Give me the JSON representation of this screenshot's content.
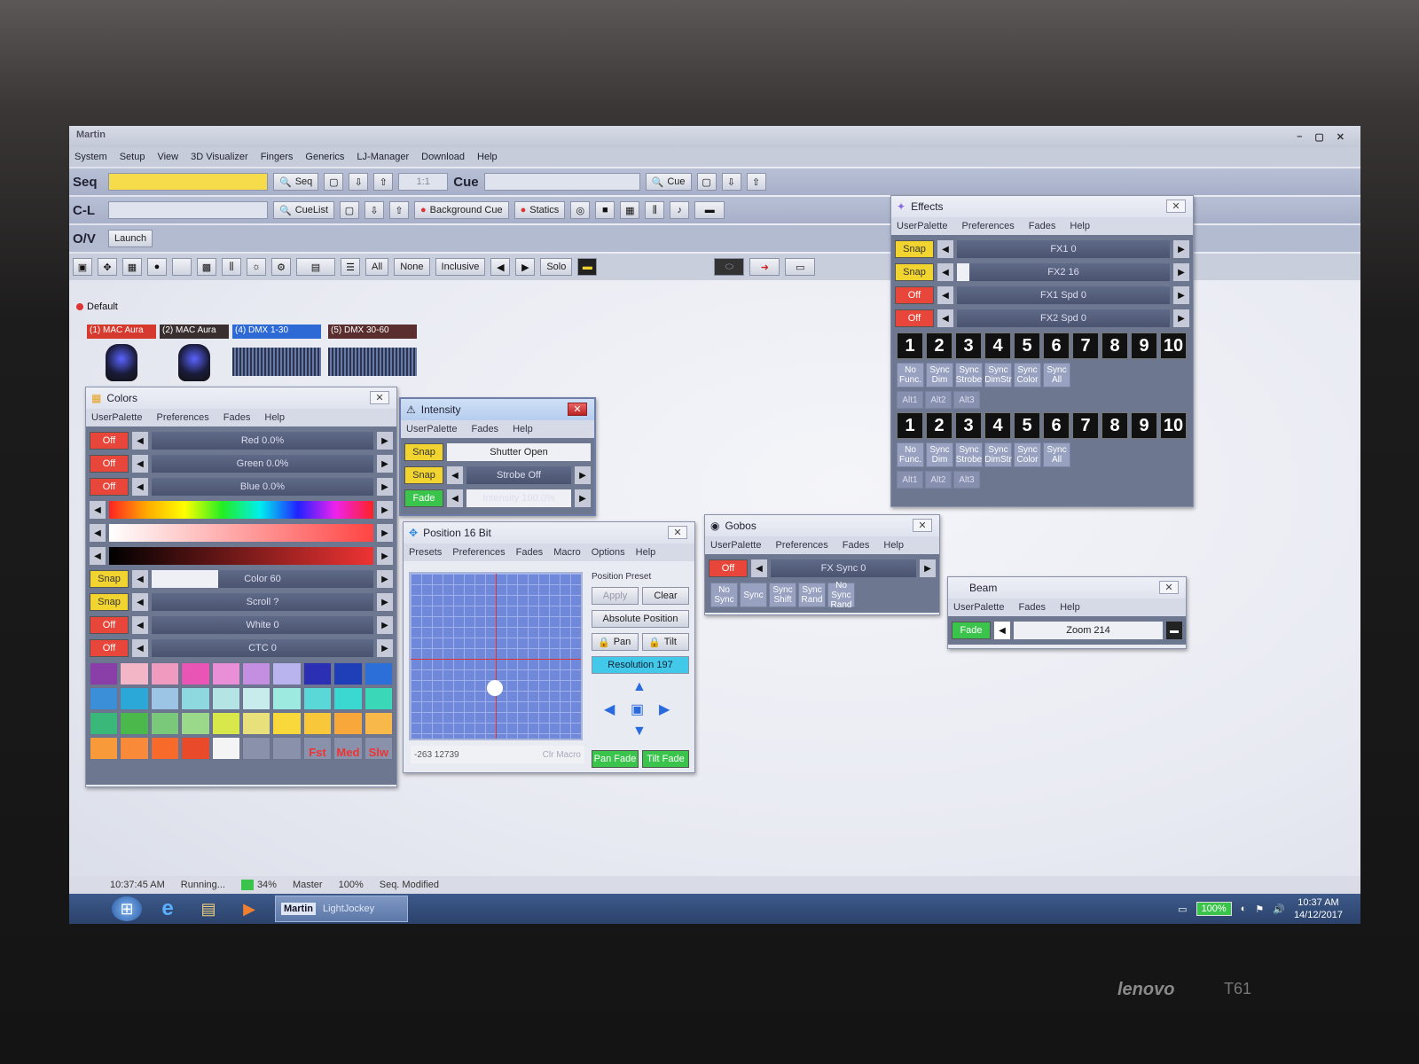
{
  "app": {
    "title": "Martin",
    "win_controls": [
      "–",
      "▢",
      "✕"
    ]
  },
  "menu": [
    "System",
    "Setup",
    "View",
    "3D Visualizer",
    "Fingers",
    "Generics",
    "LJ-Manager",
    "Download",
    "Help"
  ],
  "seq_row": {
    "label": "Seq",
    "seq_btn": "Seq",
    "ratio": "1:1",
    "cue_label": "Cue",
    "cue_btn": "Cue"
  },
  "cl_row": {
    "label": "C-L",
    "cuelist_btn": "CueList",
    "bg_cue_btn": "Background Cue",
    "statics_btn": "Statics"
  },
  "ov_row": {
    "label": "O/V",
    "launch_btn": "Launch"
  },
  "toolbar": {
    "all": "All",
    "none": "None",
    "inclusive": "Inclusive",
    "solo": "Solo"
  },
  "default_tab": "Default",
  "fixtures": [
    {
      "label": "(1) MAC Aura",
      "color": "#d63a2e"
    },
    {
      "label": "(2) MAC Aura",
      "color": "#3a2f2f"
    },
    {
      "label": "(4) DMX 1-30",
      "color": "#2e6ad6"
    },
    {
      "label": "(5) DMX 30-60",
      "color": "#5a2e2e"
    }
  ],
  "colors": {
    "title": "Colors",
    "menu": [
      "UserPalette",
      "Preferences",
      "Fades",
      "Help"
    ],
    "rows": [
      {
        "tog": "Off",
        "label": "Red 0.0%"
      },
      {
        "tog": "Off",
        "label": "Green 0.0%"
      },
      {
        "tog": "Off",
        "label": "Blue 0.0%"
      }
    ],
    "rows2": [
      {
        "tog": "Snap",
        "label": "Color 60"
      },
      {
        "tog": "Snap",
        "label": "Scroll ?"
      },
      {
        "tog": "Off",
        "label": "White 0"
      },
      {
        "tog": "Off",
        "label": "CTC 0"
      }
    ],
    "swatch_colors": [
      "#8a3ea8",
      "#f3b6c6",
      "#f09ac0",
      "#e855b4",
      "#e88fd8",
      "#c48fe0",
      "#b9b4ee",
      "#2a2fb4",
      "#1f3fb8",
      "#2c6fd8",
      "#3b8ed8",
      "#2ca8d8",
      "#9cc4e4",
      "#8ed8e0",
      "#b4e4e4",
      "#c8ecec",
      "#9ceae0",
      "#5ad8d8",
      "#3ad8d0",
      "#3ad8b8",
      "#3ab87a",
      "#4ab84a",
      "#7ac87a",
      "#9ad88a",
      "#d8e84a",
      "#e8e07a",
      "#f8d83a",
      "#f8c83a",
      "#f8a83a",
      "#f8b84a",
      "#f89a3a",
      "#f88a3a",
      "#f86a2a",
      "#e84a2a",
      "#f4f4f4",
      "#8a92ab",
      "#8a92ab",
      "#8a92ab",
      "#8a92ab",
      "#8a92ab"
    ],
    "speed": [
      "Fst",
      "Med",
      "Slw"
    ]
  },
  "intensity": {
    "title": "Intensity",
    "menu": [
      "UserPalette",
      "Fades",
      "Help"
    ],
    "shutter": "Shutter Open",
    "strobe": "Strobe Off",
    "intensity": "Intensity 100.0%",
    "tog_snap": "Snap",
    "tog_fade": "Fade",
    "level": 1.0
  },
  "position": {
    "title": "Position 16 Bit",
    "menu": [
      "Presets",
      "Preferences",
      "Fades",
      "Macro",
      "Options",
      "Help"
    ],
    "preset_label": "Position Preset",
    "apply": "Apply",
    "clear": "Clear",
    "absolute": "Absolute Position",
    "pan": "Pan",
    "tilt": "Tilt",
    "resolution": "Resolution 197",
    "coords": "-263  12739",
    "clr_macro": "Clr Macro",
    "pan_fade": "Pan Fade",
    "tilt_fade": "Tilt Fade"
  },
  "effects": {
    "title": "Effects",
    "menu": [
      "UserPalette",
      "Preferences",
      "Fades",
      "Help"
    ],
    "rows": [
      {
        "tog": "Snap",
        "label": "FX1 0",
        "level": 0.0
      },
      {
        "tog": "Snap",
        "label": "FX2 16",
        "level": 0.06
      },
      {
        "tog": "Off",
        "label": "FX1 Spd 0",
        "level": 0.0
      },
      {
        "tog": "Off",
        "label": "FX2 Spd 0",
        "level": 0.0
      }
    ],
    "nums": [
      "1",
      "2",
      "3",
      "4",
      "5",
      "6",
      "7",
      "8",
      "9",
      "10"
    ],
    "syncs": [
      "No Func.",
      "Sync Dim",
      "Sync Strobe",
      "Sync DimStr",
      "Sync Color",
      "Sync All"
    ],
    "alts": [
      "Alt1",
      "Alt2",
      "Alt3"
    ]
  },
  "gobos": {
    "title": "Gobos",
    "menu": [
      "UserPalette",
      "Preferences",
      "Fades",
      "Help"
    ],
    "tog": "Off",
    "label": "FX Sync 0",
    "syncs": [
      "No Sync",
      "Sync",
      "Sync Shift",
      "Sync Rand",
      "No Sync Rand"
    ]
  },
  "beam": {
    "title": "Beam",
    "menu": [
      "UserPalette",
      "Fades",
      "Help"
    ],
    "tog": "Fade",
    "label": "Zoom 214"
  },
  "status": {
    "time": "10:37:45 AM",
    "state": "Running...",
    "percent": "34%",
    "master": "Master",
    "master_val": "100%",
    "seq": "Seq. Modified"
  },
  "taskbar": {
    "app_label": "LightJockey",
    "app_short": "Martin",
    "battery": "100%",
    "clock_time": "10:37 AM",
    "clock_date": "14/12/2017"
  },
  "laptop": {
    "brand": "lenovo",
    "model": "T61"
  }
}
